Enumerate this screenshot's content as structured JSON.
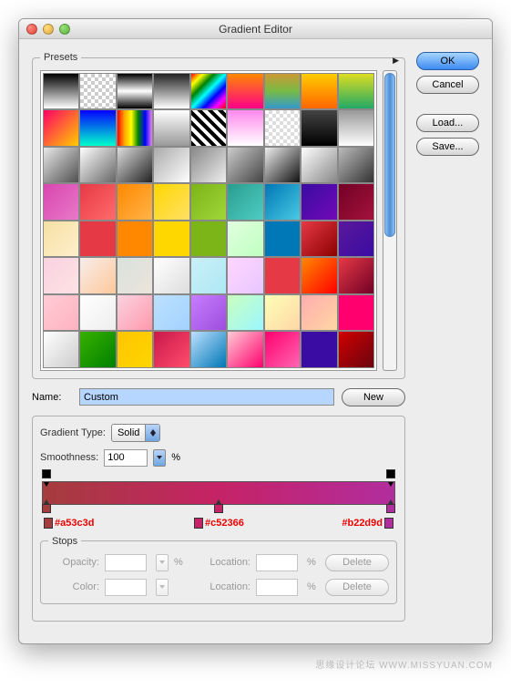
{
  "window": {
    "title": "Gradient Editor"
  },
  "buttons": {
    "ok": "OK",
    "cancel": "Cancel",
    "load": "Load...",
    "save": "Save...",
    "new": "New",
    "delete": "Delete"
  },
  "presets": {
    "legend": "Presets",
    "swatches": [
      "linear-gradient(#000,#fff)",
      "repeating-conic-gradient(#ccc 0 25%,#fff 0 50%) 0 0/8px 8px",
      "linear-gradient(#000,#fff,#000)",
      "linear-gradient(#222,#fff)",
      "linear-gradient(135deg,red,yellow,green,cyan,blue,magenta,red)",
      "linear-gradient(#ff8800,#ff0088)",
      "linear-gradient(#c93,#7b4,#39c)",
      "linear-gradient(#ffcc00,#ff6600)",
      "linear-gradient(#dd2,#2a6)",
      "linear-gradient(135deg,#f06,#fc0)",
      "linear-gradient(#0500ff,#00ffcc)",
      "linear-gradient(90deg,red,orange,yellow,green,blue,violet)",
      "linear-gradient(#fff,#999)",
      "repeating-linear-gradient(45deg,#000 0 4px,#fff 4px 8px)",
      "linear-gradient(#f8e,#fff)",
      "repeating-conic-gradient(#ddd 0 25%,#fff 0 50%) 0 0/8px 8px",
      "linear-gradient(#444,#000)",
      "linear-gradient(#999,#fff)",
      "linear-gradient(135deg,#e8e8e8,#505050)",
      "linear-gradient(135deg,#fff,#666)",
      "linear-gradient(135deg,#ddd,#222)",
      "linear-gradient(135deg,#aaa,#fff)",
      "linear-gradient(135deg,#888,#eee)",
      "linear-gradient(135deg,#ccc,#444)",
      "linear-gradient(135deg,#eee,#111)",
      "linear-gradient(135deg,#fff,#888)",
      "linear-gradient(135deg,#bbb,#333)",
      "linear-gradient(135deg,#d946b0,#e879c8)",
      "linear-gradient(135deg,#e63946,#ff6b6b)",
      "linear-gradient(135deg,#ff8800,#ffb347)",
      "linear-gradient(135deg,#ffd700,#ffe066)",
      "linear-gradient(135deg,#7cb518,#a0d639)",
      "linear-gradient(135deg,#2a9d8f,#4ecdc4)",
      "linear-gradient(135deg,#0077b6,#48cae4)",
      "linear-gradient(135deg,#3a0ca3,#7209b7)",
      "linear-gradient(135deg,#720026,#a4133c)",
      "linear-gradient(135deg,#f5e1a4,#ffeecc)",
      "linear-gradient(135deg,#e63946,#e63946)",
      "linear-gradient(135deg,#ff8800,#ff8800)",
      "linear-gradient(135deg,#ffd700,#ffd700)",
      "linear-gradient(135deg,#7cb518,#7cb518)",
      "linear-gradient(135deg,#e0ffe0,#c0ffc0)",
      "linear-gradient(135deg,#0077b6,#0077b6)",
      "linear-gradient(135deg,#e63946,#8b0000)",
      "linear-gradient(135deg,#5a189a,#3a0ca3)",
      "linear-gradient(135deg,#fad2e1,#fde2e4)",
      "linear-gradient(135deg,#f8edeb,#fec89a)",
      "linear-gradient(135deg,#d8e2dc,#ece4db)",
      "linear-gradient(135deg,#fff,#ddd)",
      "linear-gradient(135deg,#caf0f8,#ade8f4)",
      "linear-gradient(135deg,#ffd6ff,#e7c6ff)",
      "linear-gradient(135deg,#e63946,#e63946)",
      "linear-gradient(135deg,#ff8800,#ff0000)",
      "linear-gradient(135deg,#e63946,#720026)",
      "linear-gradient(135deg,#ffccd5,#ffb3c1)",
      "linear-gradient(135deg,#fff,#eee)",
      "linear-gradient(135deg,#fad2e1,#ff99ac)",
      "linear-gradient(135deg,#bde0fe,#a2d2ff)",
      "linear-gradient(135deg,#c77dff,#9d4edd)",
      "linear-gradient(135deg,#caffbf,#9bf6ff)",
      "linear-gradient(135deg,#fdffb6,#ffd6a5)",
      "linear-gradient(135deg,#ffadad,#ffd6a5)",
      "linear-gradient(135deg,#ff006e,#ff006e)",
      "linear-gradient(135deg,#fff,#ccc)",
      "linear-gradient(135deg,#38b000,#008000)",
      "linear-gradient(135deg,#fdc500,#ffd500)",
      "linear-gradient(135deg,#c9184a,#ff4d6d)",
      "linear-gradient(135deg,#bde0fe,#0077b6)",
      "linear-gradient(135deg,#ffccd5,#ff006e)",
      "linear-gradient(135deg,#ff006e,#ff66b3)",
      "linear-gradient(135deg,#3a0ca3,#3a0ca3)",
      "linear-gradient(135deg,#d00000,#6a040f)"
    ]
  },
  "name": {
    "label": "Name:",
    "value": "Custom"
  },
  "gradient": {
    "type_label": "Gradient Type:",
    "type_value": "Solid",
    "smoothness_label": "Smoothness:",
    "smoothness_value": "100",
    "pct": "%",
    "stops": [
      {
        "pos": 0,
        "hex": "#a53c3d"
      },
      {
        "pos": 50,
        "hex": "#c52366"
      },
      {
        "pos": 100,
        "hex": "#b22d9d"
      }
    ]
  },
  "stops_section": {
    "legend": "Stops",
    "opacity_label": "Opacity:",
    "color_label": "Color:",
    "location_label": "Location:",
    "pct": "%"
  },
  "watermark": "思缘设计论坛  WWW.MISSYUAN.COM"
}
